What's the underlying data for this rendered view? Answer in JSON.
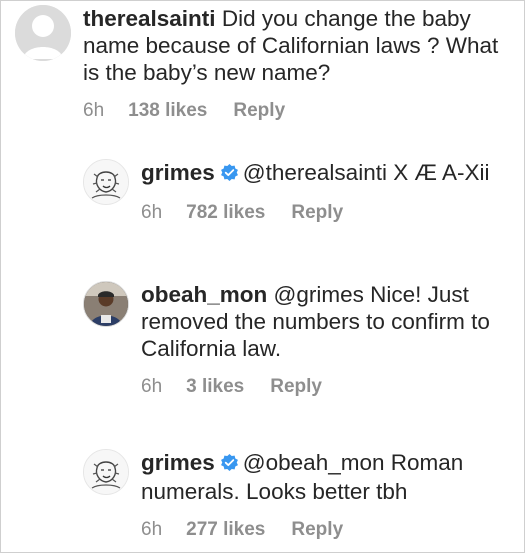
{
  "comments": [
    {
      "username": "therealsainti",
      "verified": false,
      "text": "Did you change the baby name because of Californian laws ? What is the baby’s new name?",
      "time": "6h",
      "likes": "138 likes",
      "reply": "Reply"
    },
    {
      "username": "grimes",
      "verified": true,
      "text": "@therealsainti X Æ A-Xii",
      "time": "6h",
      "likes": "782 likes",
      "reply": "Reply"
    },
    {
      "username": "obeah_mon",
      "verified": false,
      "text": "@grimes Nice! Just removed the numbers to confirm to California law.",
      "time": "6h",
      "likes": "3 likes",
      "reply": "Reply"
    },
    {
      "username": "grimes",
      "verified": true,
      "text": "@obeah_mon Roman numerals.  Looks better tbh",
      "time": "6h",
      "likes": "277 likes",
      "reply": "Reply"
    }
  ],
  "colors": {
    "text": "#262626",
    "meta": "#8e8e8e",
    "verified_badge": "#3897f0"
  }
}
